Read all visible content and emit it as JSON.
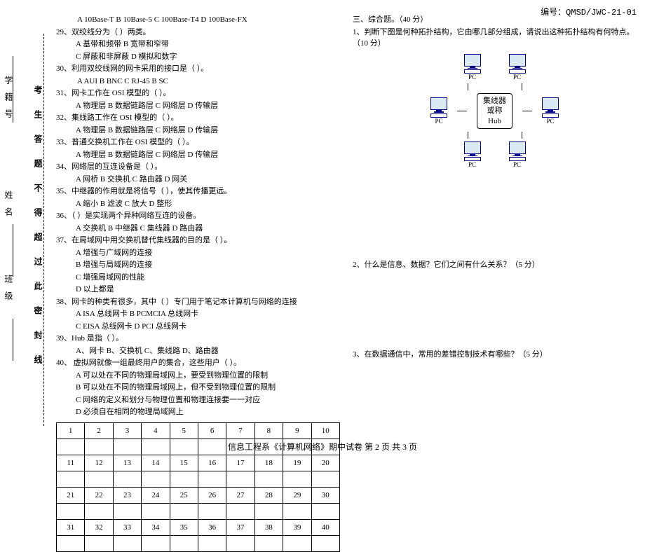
{
  "doc_id": "编号：QMSD/JWC-21-01",
  "side": {
    "banji": "班级",
    "xingming": "姓名",
    "xuejihao": "学籍号",
    "seal": "考 生 答 题 不 得 超 过 此 密 封 线"
  },
  "left": {
    "q28opts": "A 10Base-T   B 10Base-5     C 100Base-T4     D 100Base-FX",
    "q29": "29、双绞线分为（        ）两类。",
    "q29a": "A  基带和频带                 B  宽带和窄带",
    "q29b": "C  屏蔽和非屏蔽               D  模拟和数字",
    "q30": "30、利用双绞线网的网卡采用的接口是（        ）。",
    "q30o": "A AUI      B BNC     C RJ-45      B SC",
    "q31": "31、网卡工作在 OSI 模型的（        ）。",
    "q31o": "A 物理层    B 数据链路层    C 网络层    D 传输层",
    "q32": "32、集线路工作在 OSI 模型的（        ）。",
    "q32o": "A 物理层    B 数据链路层    C 网络层    D 传输层",
    "q33": "33、普通交换机工作在 OSI 模型的（        ）。",
    "q33o": "A 物理层    B 数据链路层    C 网络层    D 传输层",
    "q34": "34、网络层的互连设备是（        ）。",
    "q34o": "A 网桥      B 交换机     C 路由器     D 网关",
    "q35": "35、中继器的作用就是将信号（        ），使其传播更远。",
    "q35o": "A 缩小    B 滤波    C 放大    D 整形",
    "q36": "36、（        ）是实现两个异种网络互连的设备。",
    "q36o": "A 交换机    B 中继器    C 集线器    D 路由器",
    "q37": "37、在局域网中用交换机替代集线器的目的是（        ）。",
    "q37a": "A 增强与广域网的连接",
    "q37b": "B 增强与局域网的连接",
    "q37c": "C 增强局域网的性能",
    "q37d": "D 以上都是",
    "q38": "38、网卡的种类有很多，其中（        ）专门用于笔记本计算机与网络的连接",
    "q38a": "A ISA 总线网卡           B PCMCIA 总线网卡",
    "q38b": "C EISA 总线网卡          D PCI 总线网卡",
    "q39": "39、Hub 是指（        ）。",
    "q39o": "A、网卡    B、交换机    C、集线路    D、路由器",
    "q40": "40、    虚拟网就像一组最终用户的集合，这些用户（        ）。",
    "q40a": "A 可以处在不同的物理局域网上，要受到物理位置的限制",
    "q40b": "B 可以处在不同的物理局域网上，但不受到物理位置的限制",
    "q40c": "C 网络的定义和划分与物理位置和物理连接要一一对应",
    "q40d": "D 必须自在相同的物理局域网上"
  },
  "table": [
    "1",
    "2",
    "3",
    "4",
    "5",
    "6",
    "7",
    "8",
    "9",
    "10",
    "11",
    "12",
    "13",
    "14",
    "15",
    "16",
    "17",
    "18",
    "19",
    "20",
    "21",
    "22",
    "23",
    "24",
    "25",
    "26",
    "27",
    "28",
    "29",
    "30",
    "31",
    "32",
    "33",
    "34",
    "35",
    "36",
    "37",
    "38",
    "39",
    "40"
  ],
  "right": {
    "sec3": "三、综合题。（40 分）",
    "r1": "1、判断下图是何种拓扑结构，它由哪几部分组成，请说出这种拓扑结构有何特点。（10 分）",
    "hub1": "集线器",
    "hub2": "或称",
    "hub3": "Hub",
    "pc": "PC",
    "r2": "2、什么是信息、数据？它们之间有什么关系？（5 分）",
    "r3": "3、在数据通信中，常用的差错控制技术有哪些？（5 分）"
  },
  "footer": "信息工程系《计算机网络》期中试卷 第 2 页 共 3 页"
}
